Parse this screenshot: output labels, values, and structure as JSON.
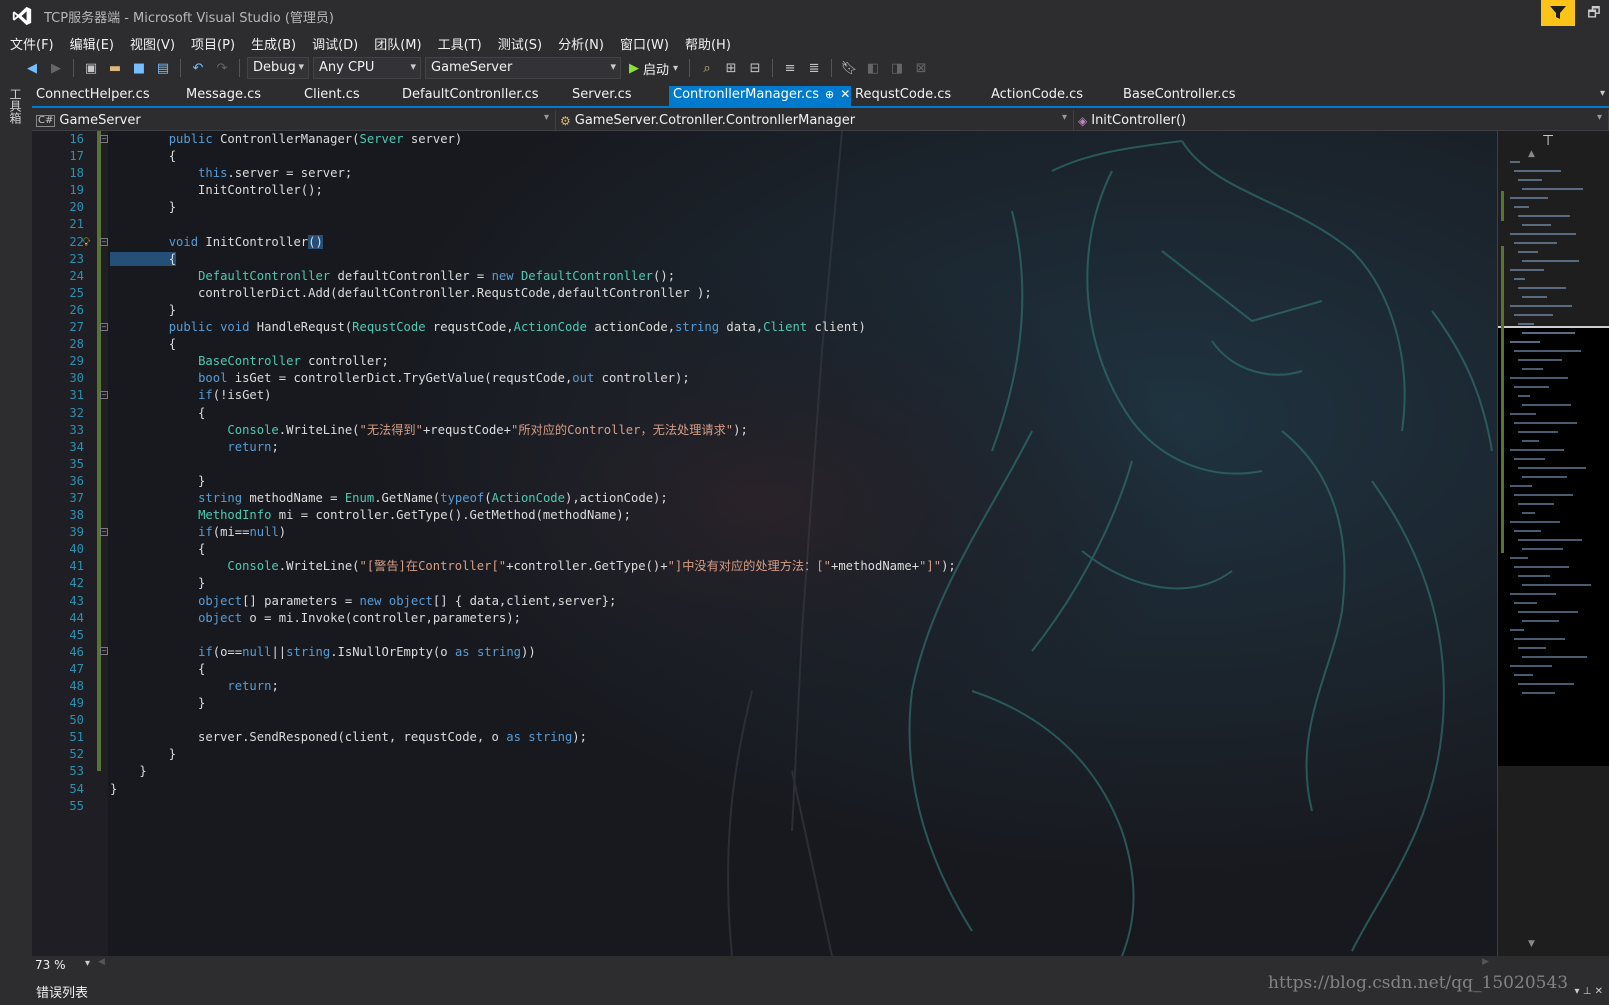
{
  "window": {
    "title": "TCP服务器端 - Microsoft Visual Studio (管理员)"
  },
  "menu": [
    "文件(F)",
    "编辑(E)",
    "视图(V)",
    "项目(P)",
    "生成(B)",
    "调试(D)",
    "团队(M)",
    "工具(T)",
    "测试(S)",
    "分析(N)",
    "窗口(W)",
    "帮助(H)"
  ],
  "toolbar": {
    "config": "Debug",
    "platform": "Any CPU",
    "startup_project": "GameServer",
    "start_label": "启动"
  },
  "toolbox_label": "工具箱",
  "tabs": [
    {
      "label": "ConnectHelper.cs",
      "active": false
    },
    {
      "label": "Message.cs",
      "active": false
    },
    {
      "label": "Client.cs",
      "active": false
    },
    {
      "label": "DefaultContronller.cs",
      "active": false
    },
    {
      "label": "Server.cs",
      "active": false
    },
    {
      "label": "ContronllerManager.cs",
      "active": true
    },
    {
      "label": "RequstCode.cs",
      "active": false
    },
    {
      "label": "ActionCode.cs",
      "active": false
    },
    {
      "label": "BaseController.cs",
      "active": false
    }
  ],
  "navbar": {
    "project": "GameServer",
    "type": "GameServer.Cotronller.ContronllerManager",
    "member": "InitController()"
  },
  "line_numbers": [
    "16",
    "17",
    "18",
    "19",
    "20",
    "21",
    "22",
    "23",
    "24",
    "25",
    "26",
    "27",
    "28",
    "29",
    "30",
    "31",
    "32",
    "33",
    "34",
    "35",
    "36",
    "37",
    "38",
    "39",
    "40",
    "41",
    "42",
    "43",
    "44",
    "45",
    "46",
    "47",
    "48",
    "49",
    "50",
    "51",
    "52",
    "53",
    "54",
    "55"
  ],
  "zoom": "73 %",
  "bottom_panel": {
    "error_list_label": "错误列表"
  },
  "watermark": "https://blog.csdn.net/qq_15020543",
  "colors": {
    "accent": "#007acc",
    "keyword": "#569cd6",
    "type": "#4ec9b0",
    "string": "#d69d85",
    "line_number": "#2b91af",
    "feedback": "#fcc419"
  }
}
